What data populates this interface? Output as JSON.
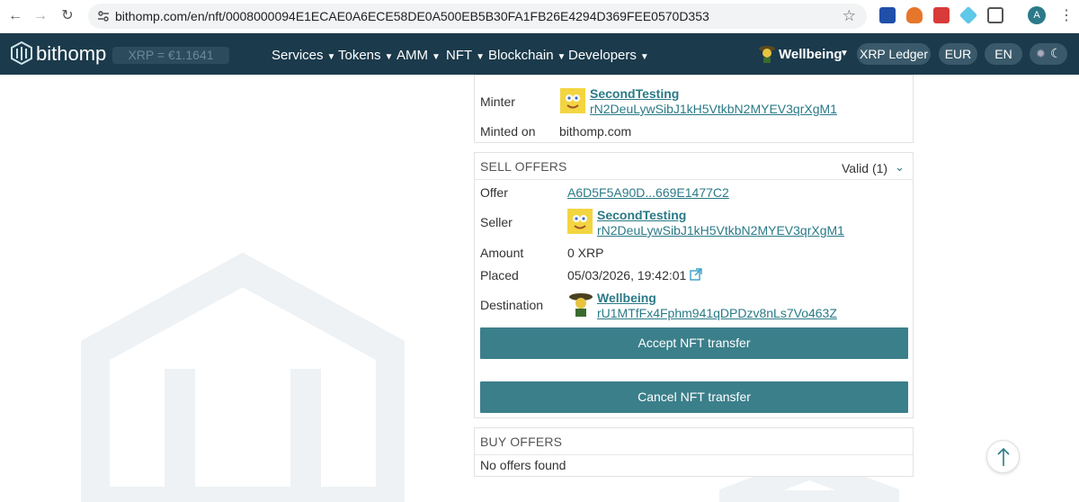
{
  "browser": {
    "url": "bithomp.com/en/nft/0008000094E1ECAE0A6ECE58DE0A500EB5B30FA1FB26E4294D369FEE0570D353",
    "profile_initial": "A"
  },
  "header": {
    "logo": "bithomp",
    "price": "XRP = €1.1641",
    "menu": [
      "Services",
      "Tokens",
      "AMM",
      "NFT",
      "Blockchain",
      "Developers"
    ],
    "user_name": "Wellbeing",
    "network": "XRP Ledger",
    "currency": "EUR",
    "language": "EN"
  },
  "nft_info": {
    "minter_label": "Minter",
    "minter_name": "SecondTesting",
    "minter_address": "rN2DeuLywSibJ1kH5VtkbN2MYEV3qrXgM1",
    "minted_on_label": "Minted on",
    "minted_on_value": "bithomp.com"
  },
  "sell_offers": {
    "title": "SELL OFFERS",
    "filter": "Valid (1)",
    "offer_label": "Offer",
    "offer_value": "A6D5F5A90D...669E1477C2",
    "seller_label": "Seller",
    "seller_name": "SecondTesting",
    "seller_address": "rN2DeuLywSibJ1kH5VtkbN2MYEV3qrXgM1",
    "amount_label": "Amount",
    "amount_value": "0 XRP",
    "placed_label": "Placed",
    "placed_value": "05/03/2026, 19:42:01",
    "destination_label": "Destination",
    "destination_name": "Wellbeing",
    "destination_address": "rU1MTfFx4Fphm941qDPDzv8nLs7Vo463Z",
    "accept_button": "Accept NFT transfer",
    "cancel_button": "Cancel NFT transfer"
  },
  "buy_offers": {
    "title": "BUY OFFERS",
    "empty": "No offers found"
  },
  "colors": {
    "header_bg": "#1b3a4b",
    "accent": "#3b7f8a",
    "link": "#2a7a87"
  }
}
